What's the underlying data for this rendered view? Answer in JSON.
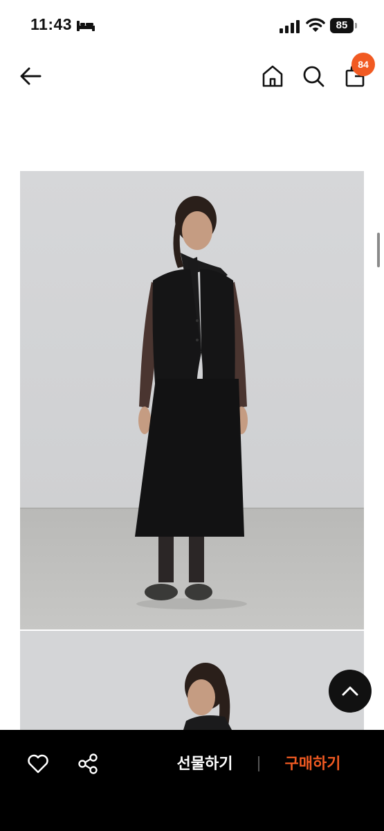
{
  "status_bar": {
    "time": "11:43",
    "battery_level": "85",
    "icons": [
      "bed-icon",
      "signal-icon",
      "wifi-icon",
      "battery-icon"
    ]
  },
  "header": {
    "icons": [
      "back-arrow-icon",
      "home-icon",
      "search-icon",
      "shopping-bag-icon"
    ],
    "cart_count": "84",
    "badge_color": "#f15a22"
  },
  "product": {
    "images": [
      "product-photo-full-body",
      "product-photo-detail"
    ]
  },
  "bottom_bar": {
    "like_icon": "heart-icon",
    "share_icon": "share-icon",
    "gift_label": "선물하기",
    "buy_label": "구매하기",
    "buy_color": "#f15a22",
    "background": "#000000"
  },
  "scroll_top_icon": "chevron-up-icon"
}
